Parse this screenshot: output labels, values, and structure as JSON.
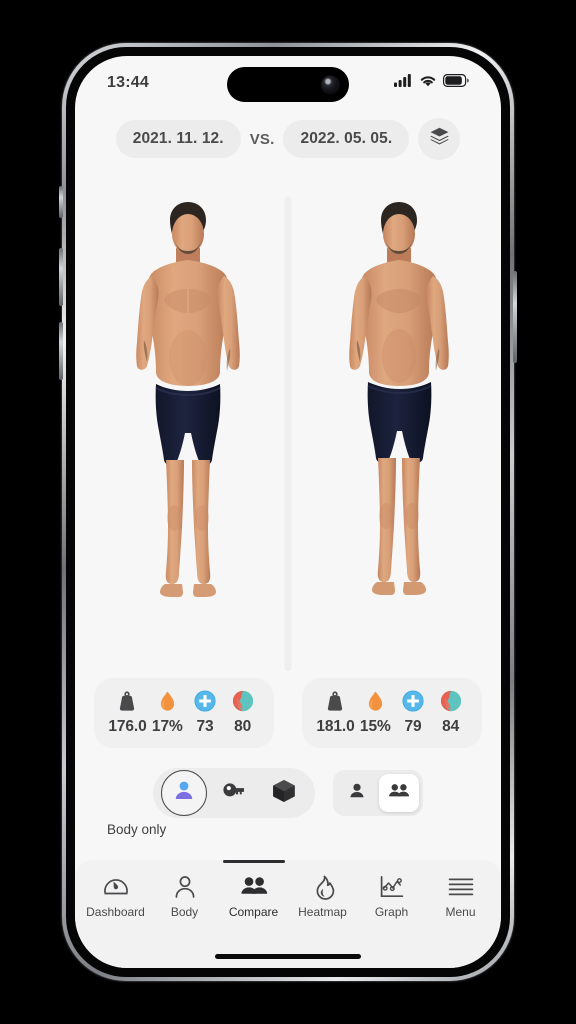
{
  "status_bar": {
    "time": "13:44",
    "cellular_icon": "signal-bars-icon",
    "wifi_icon": "wifi-icon",
    "battery_icon": "battery-icon"
  },
  "date_selector": {
    "date_left": "2021. 11. 12.",
    "vs": "VS.",
    "date_right": "2022. 05. 05.",
    "layers_icon": "layers-icon"
  },
  "comparison": {
    "left": {
      "metrics": [
        {
          "icon": "weight-scale-icon",
          "value": "176.0",
          "color": "#4a4a4c"
        },
        {
          "icon": "body-fat-drop-icon",
          "value": "17%",
          "color": "#f2923f"
        },
        {
          "icon": "health-score-icon",
          "value": "73",
          "color": "#56b7e8"
        },
        {
          "icon": "balance-yinyang-icon",
          "value": "80",
          "color": "#e8604f"
        }
      ]
    },
    "right": {
      "metrics": [
        {
          "icon": "weight-scale-icon",
          "value": "181.0",
          "color": "#4a4a4c"
        },
        {
          "icon": "body-fat-drop-icon",
          "value": "15%",
          "color": "#f2923f"
        },
        {
          "icon": "health-score-icon",
          "value": "79",
          "color": "#56b7e8"
        },
        {
          "icon": "balance-yinyang-icon",
          "value": "84",
          "color": "#e8604f"
        }
      ]
    }
  },
  "view_modes": {
    "caption": "Body only",
    "options": [
      {
        "icon": "body-only-icon",
        "selected": true
      },
      {
        "icon": "key-icon",
        "selected": false
      },
      {
        "icon": "cube-3d-icon",
        "selected": false
      }
    ],
    "segmented": [
      {
        "icon": "single-person-icon",
        "active": false
      },
      {
        "icon": "two-people-icon",
        "active": true
      }
    ]
  },
  "bottom_nav": {
    "items": [
      {
        "label": "Dashboard",
        "icon": "gauge-icon",
        "active": false
      },
      {
        "label": "Body",
        "icon": "person-icon",
        "active": false
      },
      {
        "label": "Compare",
        "icon": "compare-icon",
        "active": true
      },
      {
        "label": "Heatmap",
        "icon": "flame-icon",
        "active": false
      },
      {
        "label": "Graph",
        "icon": "line-chart-icon",
        "active": false
      },
      {
        "label": "Menu",
        "icon": "hamburger-icon",
        "active": false
      }
    ]
  },
  "colors": {
    "screen_bg": "#f7f7f7",
    "chip_bg": "#ececec",
    "text": "#4a4a4c",
    "accent_orange": "#f2923f",
    "accent_blue": "#56b7e8",
    "accent_red": "#e8604f",
    "accent_teal": "#5fc4c0"
  }
}
